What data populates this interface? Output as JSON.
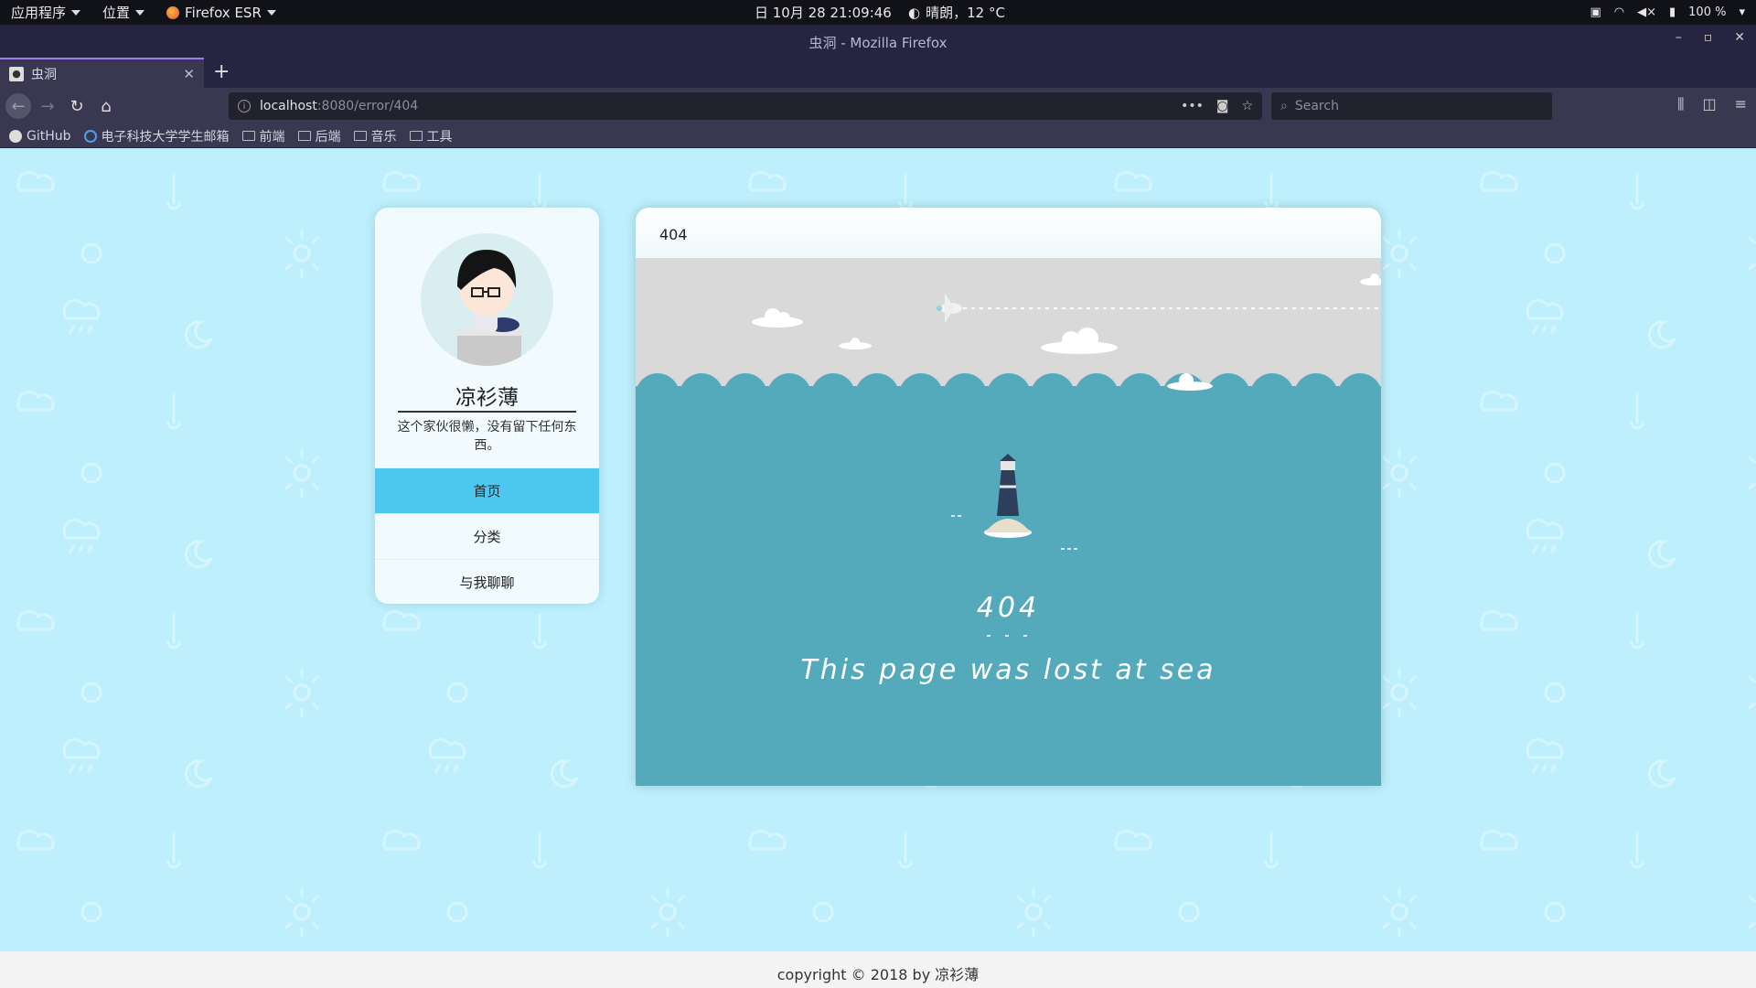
{
  "topbar": {
    "apps_label": "应用程序",
    "places_label": "位置",
    "browser_label": "Firefox ESR",
    "clock": "日 10月 28  21:09:46",
    "weather": "晴朗，12 °C",
    "battery": "100 %"
  },
  "window": {
    "title": "虫洞 - Mozilla Firefox"
  },
  "tab": {
    "title": "虫洞"
  },
  "navbar": {
    "url_host": "localhost",
    "url_path": ":8080/error/404",
    "search_placeholder": "Search"
  },
  "bookmarks": [
    {
      "label": "GitHub",
      "icon": "github-icon"
    },
    {
      "label": "电子科技大学学生邮箱",
      "icon": "mail-icon"
    },
    {
      "label": "前端",
      "icon": "folder-icon"
    },
    {
      "label": "后端",
      "icon": "folder-icon"
    },
    {
      "label": "音乐",
      "icon": "folder-icon"
    },
    {
      "label": "工具",
      "icon": "folder-icon"
    }
  ],
  "profile": {
    "name": "凉衫薄",
    "bio": "这个家伙很懒，没有留下任何东西。",
    "menu": {
      "home": "首页",
      "category": "分类",
      "chat": "与我聊聊"
    }
  },
  "panel": {
    "header": "404",
    "big_code": "404",
    "message": "This page was lost at sea"
  },
  "footer": {
    "text": "copyright © 2018 by 凉衫薄"
  },
  "colors": {
    "page_bg": "#bdeffc",
    "accent": "#4ec7f0",
    "sea": "#54aabb",
    "sky": "#d9d9d9"
  }
}
